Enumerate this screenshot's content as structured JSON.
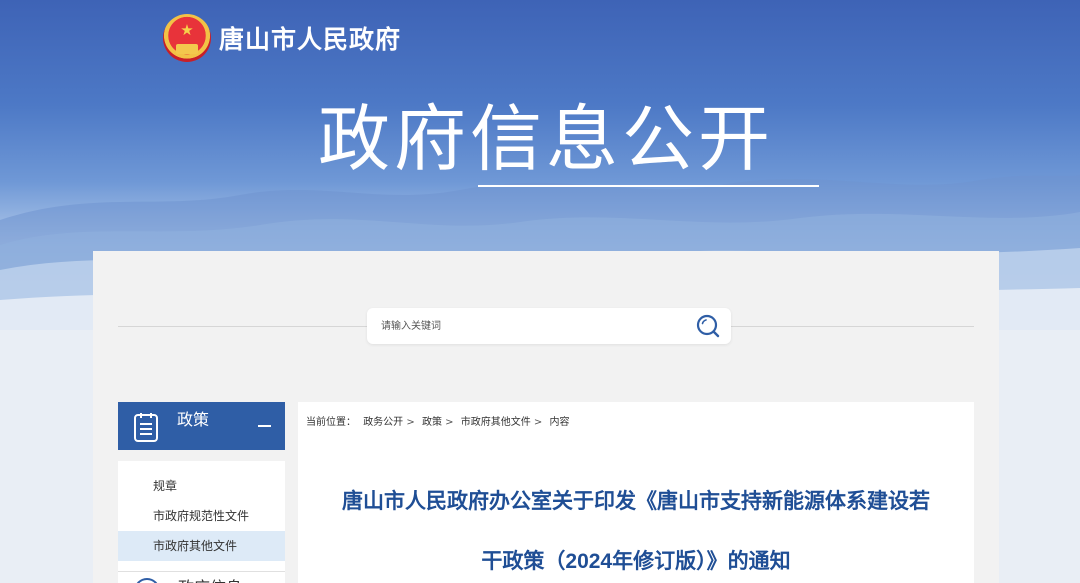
{
  "brand": {
    "name": "唐山市人民政府",
    "emblem_icon": "national-emblem-icon"
  },
  "hero": {
    "title": "政府信息公开"
  },
  "search": {
    "placeholder": "请输入关键词",
    "button_icon": "search-icon"
  },
  "sidebar": {
    "section1": {
      "title": "政策",
      "icon": "document-icon",
      "toggle_icon": "minus-icon",
      "items": [
        {
          "label": "规章",
          "active": false
        },
        {
          "label": "市政府规范性文件",
          "active": false
        },
        {
          "label": "市政府其他文件",
          "active": true
        }
      ]
    },
    "section2": {
      "title": "政府信息"
    }
  },
  "breadcrumb": {
    "prefix": "当前位置：",
    "items": [
      "政务公开",
      "政策",
      "市政府其他文件",
      "内容"
    ],
    "separator": ">"
  },
  "article": {
    "title_line1": "唐山市人民政府办公室关于印发《唐山市支持新能源体系建设若",
    "title_line2": "干政策（2024年修订版）》的通知"
  },
  "colors": {
    "primary_blue": "#2f5ea6",
    "title_blue": "#1f4e95",
    "active_bg": "#ddeaf7"
  }
}
